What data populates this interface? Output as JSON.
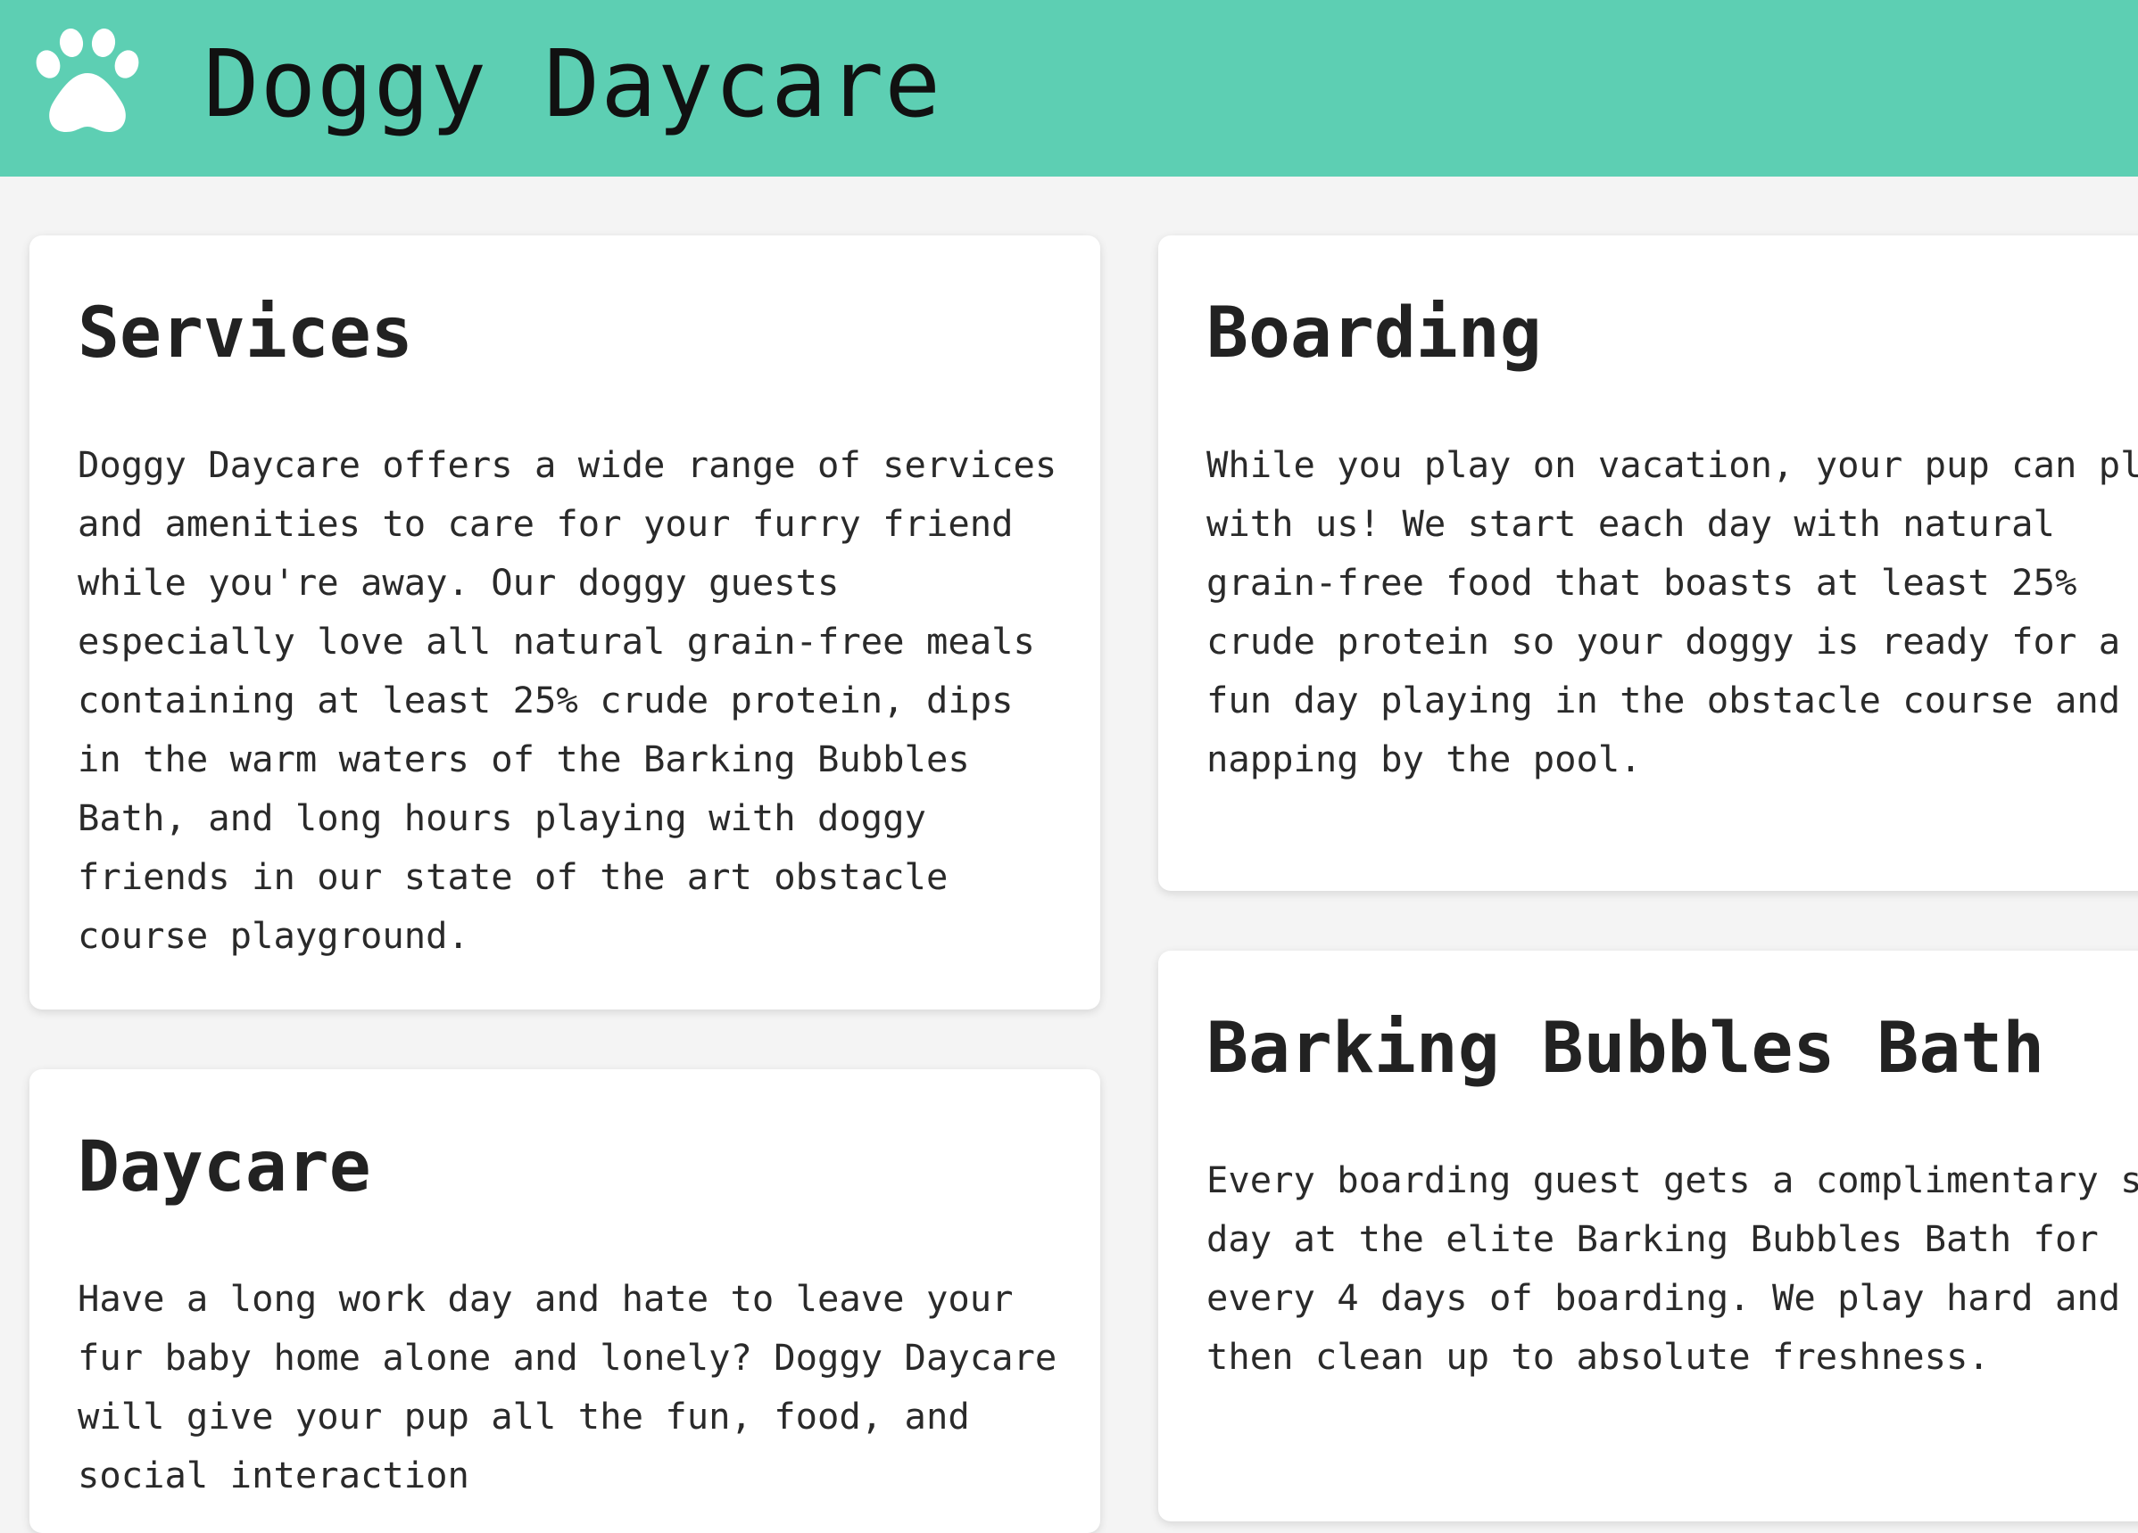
{
  "header": {
    "logo_icon": "paw-icon",
    "title": "Doggy Daycare",
    "background_color": "#5dcfb3"
  },
  "cards": {
    "services": {
      "title": "Services",
      "body": "Doggy Daycare offers a wide range of services\nand amenities to care for your furry friend\nwhile you're away. Our doggy guests\nespecially love all natural grain-free meals\ncontaining at least 25% crude protein, dips\nin the warm waters of the Barking Bubbles\nBath, and long hours playing with doggy\nfriends in our state of the art obstacle\ncourse playground."
    },
    "boarding": {
      "title": "Boarding",
      "body": "While you play on vacation, your pup can play\nwith us! We start each day with natural\ngrain-free food that boasts at least 25%\ncrude protein so your doggy is ready for a\nfun day playing in the obstacle course and\nnapping by the pool."
    },
    "bath": {
      "title": "Barking Bubbles Bath",
      "body": "Every boarding guest gets a complimentary spa\nday at the elite Barking Bubbles Bath for\nevery 4 days of boarding. We play hard and\nthen clean up to absolute freshness."
    },
    "daycare": {
      "title": "Daycare",
      "body": "Have a long work day and hate to leave your\nfur baby home alone and lonely? Doggy Daycare\nwill give your pup all the fun, food, and\nsocial interaction"
    }
  }
}
